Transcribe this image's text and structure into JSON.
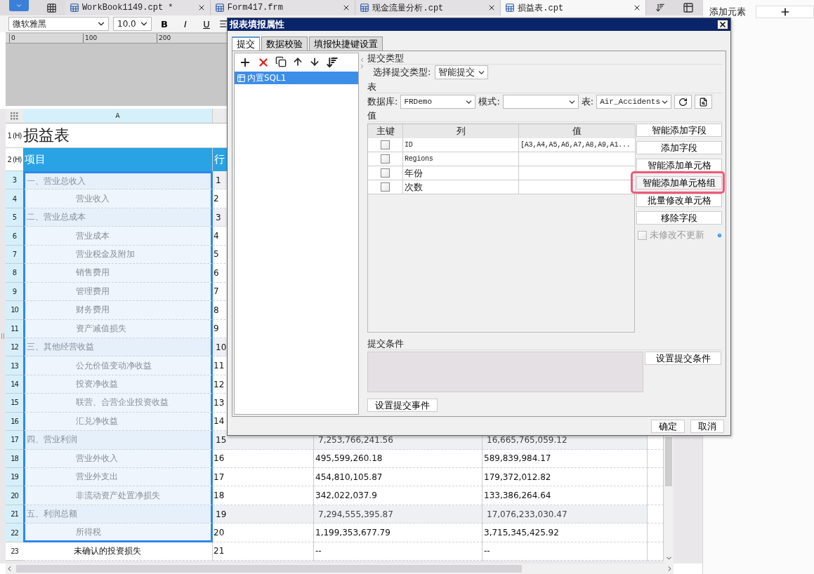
{
  "file_tabs": [
    {
      "label": "WorkBook1149.cpt *",
      "selected": false
    },
    {
      "label": "Form417.frm",
      "selected": false
    },
    {
      "label": "现金流量分析.cpt",
      "selected": false
    },
    {
      "label": "损益表.cpt",
      "selected": true
    }
  ],
  "right_panel": {
    "title": "添加元素"
  },
  "toolbar": {
    "font": "微软雅黑",
    "size": "10.0",
    "bold": "B",
    "italic": "I",
    "underline": "U"
  },
  "ruler": {
    "marks": [
      "0",
      "100",
      "200"
    ]
  },
  "sheet": {
    "columns": [
      "A"
    ],
    "title_row": {
      "number": "1 (H)",
      "text": "损益表"
    },
    "header_row": {
      "number": "2 (H)",
      "cells": [
        "项目",
        "行"
      ]
    },
    "rows": [
      {
        "number": "3",
        "kind": "section",
        "selected": true,
        "cells": [
          "一、营业总收入",
          "1"
        ]
      },
      {
        "number": "4",
        "kind": "item",
        "selected": true,
        "cells": [
          "营业收入",
          "2"
        ]
      },
      {
        "number": "5",
        "kind": "section",
        "selected": true,
        "cells": [
          "二、营业总成本",
          "3"
        ]
      },
      {
        "number": "6",
        "kind": "item",
        "selected": true,
        "cells": [
          "营业成本",
          "4"
        ]
      },
      {
        "number": "7",
        "kind": "item",
        "selected": true,
        "cells": [
          "营业税金及附加",
          "5"
        ]
      },
      {
        "number": "8",
        "kind": "item",
        "selected": true,
        "cells": [
          "销售费用",
          "6"
        ]
      },
      {
        "number": "9",
        "kind": "item",
        "selected": true,
        "cells": [
          "管理费用",
          "7"
        ]
      },
      {
        "number": "10",
        "kind": "item",
        "selected": true,
        "cells": [
          "财务费用",
          "8"
        ]
      },
      {
        "number": "11",
        "kind": "item",
        "selected": true,
        "cells": [
          "资产减值损失",
          "9"
        ]
      },
      {
        "number": "12",
        "kind": "section",
        "selected": true,
        "cells": [
          "三、其他经营收益",
          "10"
        ]
      },
      {
        "number": "13",
        "kind": "item",
        "selected": true,
        "cells": [
          "公允价值变动净收益",
          "11"
        ]
      },
      {
        "number": "14",
        "kind": "item",
        "selected": true,
        "cells": [
          "投资净收益",
          "12"
        ]
      },
      {
        "number": "15",
        "kind": "item",
        "selected": true,
        "cells": [
          "联营、合营企业投资收益",
          "13"
        ]
      },
      {
        "number": "16",
        "kind": "item",
        "selected": true,
        "cells": [
          "汇兑净收益",
          "14"
        ]
      },
      {
        "number": "17",
        "kind": "section",
        "selected": true,
        "cells": [
          "四、营业利润",
          "15",
          "7,253,766,241.56",
          "16,665,765,059.12"
        ]
      },
      {
        "number": "18",
        "kind": "item",
        "selected": true,
        "cells": [
          "营业外收入",
          "16",
          "495,599,260.18",
          "589,839,984.17"
        ]
      },
      {
        "number": "19",
        "kind": "item",
        "selected": true,
        "cells": [
          "营业外支出",
          "17",
          "454,810,105.87",
          "179,372,012.82"
        ]
      },
      {
        "number": "20",
        "kind": "item",
        "selected": true,
        "cells": [
          "非流动资产处置净损失",
          "18",
          "342,022,037.9",
          "133,386,264.64"
        ]
      },
      {
        "number": "21",
        "kind": "section",
        "selected": true,
        "cells": [
          "五、利润总额",
          "19",
          "7,294,555,395.87",
          "17,076,233,030.47"
        ]
      },
      {
        "number": "22",
        "kind": "item",
        "selected": true,
        "cells": [
          "所得税",
          "20",
          "1,199,353,677.79",
          "3,715,345,425.92"
        ]
      },
      {
        "number": "23",
        "kind": "item",
        "selected": false,
        "cells": [
          "未确认的投资损失",
          "21",
          "--",
          "--"
        ]
      }
    ]
  },
  "dialog": {
    "title": "报表填报属性",
    "tabs": [
      {
        "label": "提交",
        "selected": true
      },
      {
        "label": "数据校验",
        "selected": false
      },
      {
        "label": "填报快捷键设置",
        "selected": false
      }
    ],
    "sources": [
      {
        "label": "内置SQL1",
        "selected": true
      }
    ],
    "submit_type": {
      "section": "提交类型",
      "label": "选择提交类型:",
      "value": "智能提交"
    },
    "table_section": {
      "section": "表",
      "db_label": "数据库:",
      "db": "FRDemo",
      "schema_label": "模式:",
      "table_label": "表:",
      "table": "Air_Accidents"
    },
    "values": {
      "section": "值",
      "columns": [
        "主键",
        "列",
        "值"
      ],
      "rows": [
        {
          "key": false,
          "column": "ID",
          "value": "[A3,A4,A5,A6,A7,A8,A9,A1..."
        },
        {
          "key": false,
          "column": "Regions"
        },
        {
          "key": false,
          "column": "年份"
        },
        {
          "key": false,
          "column": "次数"
        }
      ]
    },
    "side_buttons": [
      {
        "label": "智能添加字段",
        "highlighted": false
      },
      {
        "label": "添加字段",
        "highlighted": false
      },
      {
        "label": "智能添加单元格",
        "highlighted": false
      },
      {
        "label": "智能添加单元格组",
        "highlighted": true
      },
      {
        "label": "批量修改单元格",
        "highlighted": false
      },
      {
        "label": "移除字段",
        "highlighted": false
      }
    ],
    "no_update": {
      "label": "未修改不更新",
      "checked": false,
      "disabled": true
    },
    "condition": {
      "section": "提交条件",
      "button": "设置提交条件"
    },
    "event_button": "设置提交事件",
    "footer": [
      "确定",
      "取消"
    ]
  }
}
